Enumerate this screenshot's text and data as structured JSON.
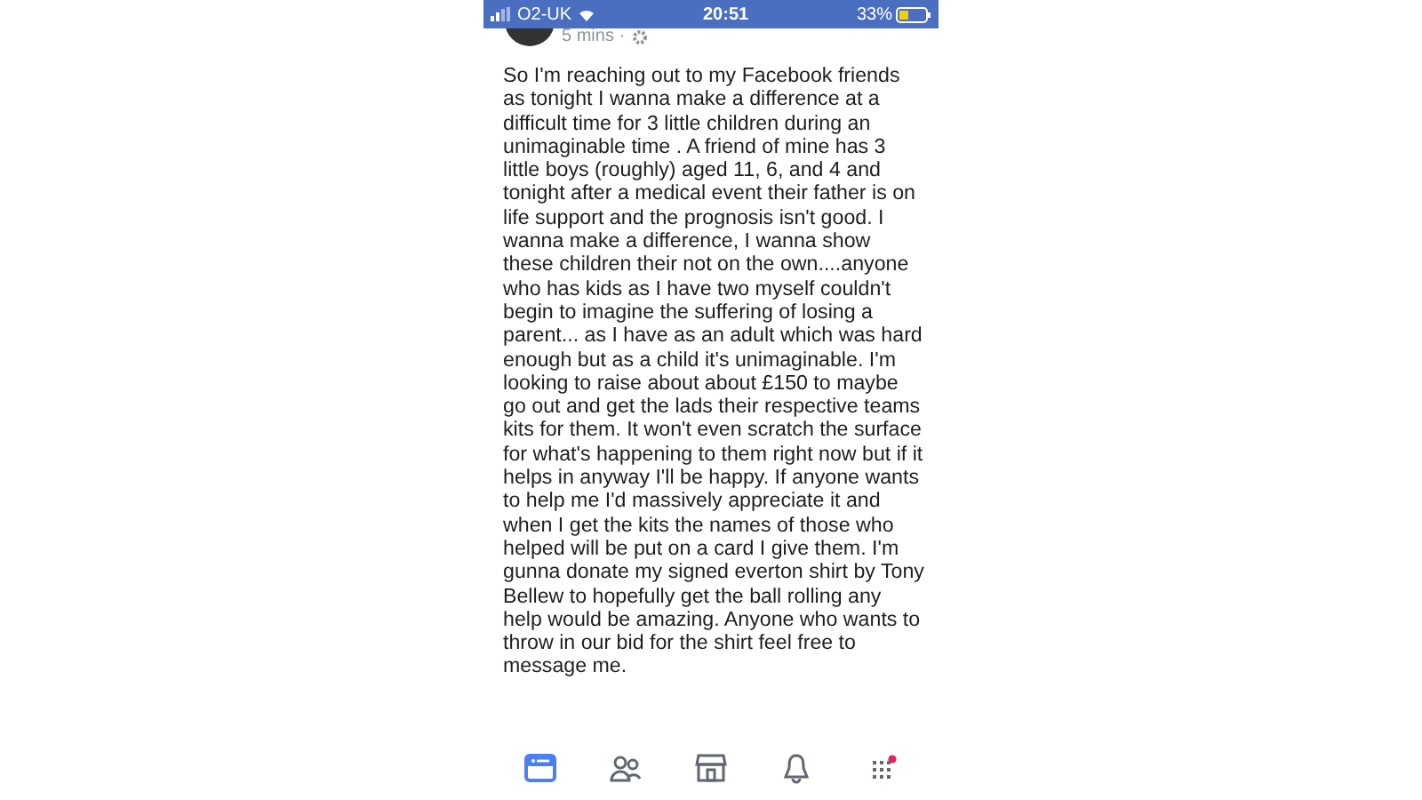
{
  "status_bar": {
    "carrier": "O2-UK",
    "time": "20:51",
    "battery": "33%"
  },
  "post": {
    "timestamp": "5 mins ·",
    "text": "So I'm reaching out to my Facebook friends as tonight I wanna make a difference at a difficult time for 3 little children during an unimaginable time . A friend of mine has 3 little boys (roughly) aged 11, 6, and 4 and tonight after a medical event their father is on life support and the prognosis isn't good. I wanna make a difference, I wanna show these children their not on the own....anyone who has kids as I have two myself couldn't begin to imagine the suffering of losing a parent... as I have as an adult which was hard enough but as a child it's unimaginable. I'm looking to raise about about £150 to maybe go out and get the lads their respective teams kits for them. It won't even scratch the surface for what's happening to them right now but if it helps in anyway I'll be happy. If anyone wants to help me I'd massively appreciate it and when I get the kits the names of those who helped will be put on a card I give them. I'm gunna donate my signed everton shirt by Tony Bellew to hopefully get the ball rolling any help would be amazing. Anyone who wants to throw in our bid for the shirt feel free to message me."
  },
  "tab_bar": [
    {
      "kind": "feed",
      "selected": true,
      "badge": false
    },
    {
      "kind": "friends",
      "selected": false,
      "badge": false
    },
    {
      "kind": "marketplace",
      "selected": false,
      "badge": false
    },
    {
      "kind": "notifications",
      "selected": false,
      "badge": false
    },
    {
      "kind": "menu",
      "selected": false,
      "badge": true
    }
  ]
}
